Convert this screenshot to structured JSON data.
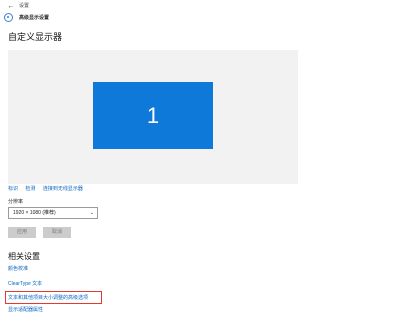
{
  "window": {
    "back_glyph": "←",
    "app_title": "设置"
  },
  "header": {
    "breadcrumb": "高级显示设置"
  },
  "page": {
    "title": "自定义显示器"
  },
  "display": {
    "monitor_number": "1",
    "links": [
      "标识",
      "检测",
      "连接到无线显示器"
    ]
  },
  "resolution": {
    "label": "分辨率",
    "value": "1920 × 1080 (推荐)"
  },
  "buttons": {
    "apply_label": "应用",
    "cancel_label": "取消"
  },
  "related": {
    "title": "相关设置",
    "links": [
      "颜色校准",
      "ClearType 文本",
      "文本和其他项目大小调整的高级选项",
      "显示适配器属性"
    ]
  },
  "colors": {
    "accent": "#0e79d8",
    "link": "#0a66c2",
    "highlight": "#e33a2f"
  },
  "icons": {
    "back": "back-arrow-icon",
    "settings": "gear-icon",
    "dropdown": "chevron-down-icon"
  }
}
